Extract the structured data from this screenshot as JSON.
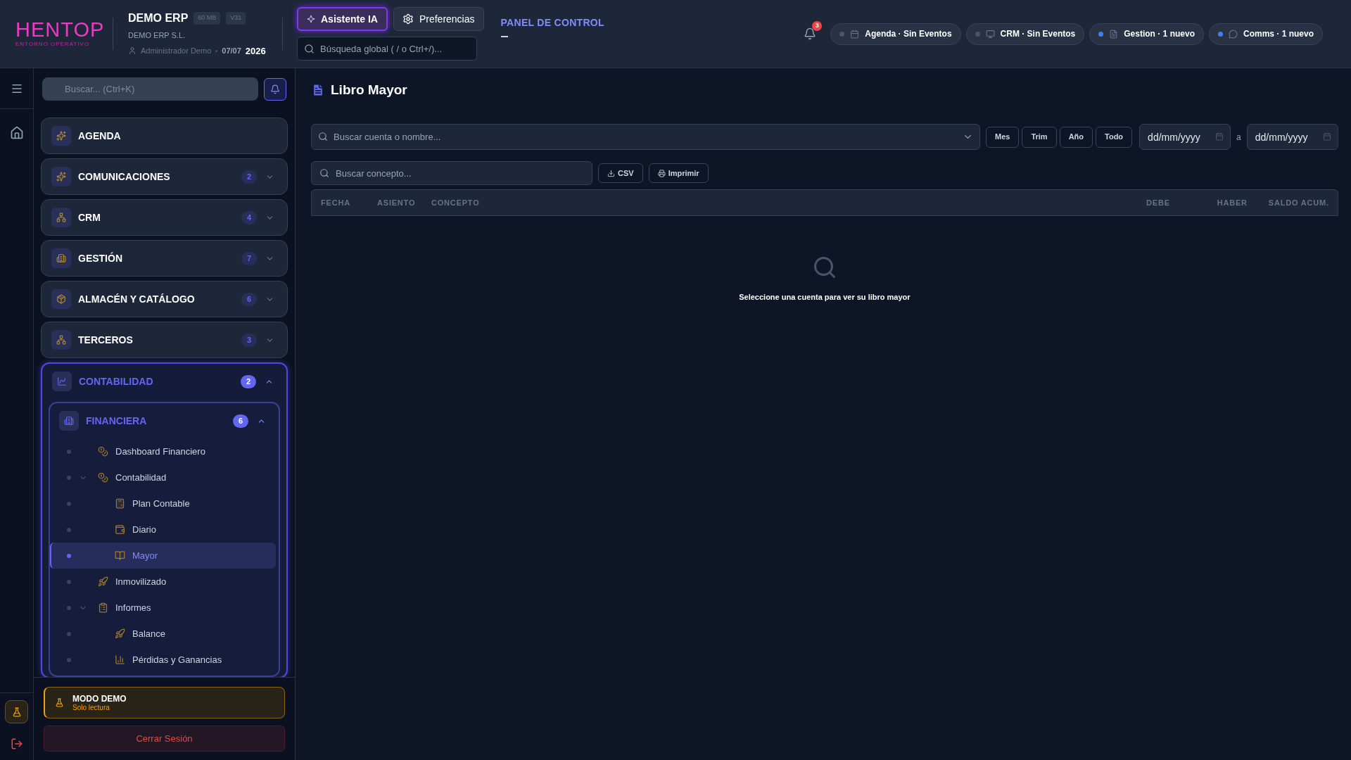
{
  "header": {
    "logo": {
      "name": "HENTOP",
      "tagline": "ENTORNO OPERATIVO"
    },
    "company": {
      "name": "DEMO ERP",
      "badges": [
        "60 MB",
        "V31"
      ],
      "legal_name": "DEMO ERP S.L.",
      "user": "Administrador Demo",
      "date": "07/07",
      "year": "2026"
    },
    "buttons": [
      {
        "label": "Asistente IA",
        "kind": "ai",
        "selected": true
      },
      {
        "label": "Preferencias",
        "kind": "settings",
        "selected": false
      }
    ],
    "global_search": {
      "placeholder": "Búsqueda global ( / o Ctrl+/)..."
    },
    "panel_link": "PANEL DE CONTROL",
    "notifications": "3",
    "status_pills": [
      {
        "label": "Agenda · Sin Eventos",
        "kind": "calendar",
        "active": false
      },
      {
        "label": "CRM · Sin Eventos",
        "kind": "screen",
        "active": false
      },
      {
        "label": "Gestion · 1 nuevo",
        "kind": "file",
        "active": true
      },
      {
        "label": "Comms · 1 nuevo",
        "kind": "chat",
        "active": true
      }
    ]
  },
  "sidebar": {
    "search": {
      "placeholder": "Buscar... (Ctrl+K)"
    },
    "modules": [
      {
        "label": "AGENDA",
        "expanded": false
      },
      {
        "label": "COMUNICACIONES",
        "count": "2",
        "expanded": false
      },
      {
        "label": "CRM",
        "count": "4",
        "expanded": false
      },
      {
        "label": "GESTIÓN",
        "count": "7",
        "expanded": false
      },
      {
        "label": "ALMACÉN Y CATÁLOGO",
        "count": "6",
        "expanded": false
      },
      {
        "label": "TERCEROS",
        "count": "3",
        "expanded": false
      },
      {
        "label": "CONTABILIDAD",
        "count": "2",
        "expanded": true,
        "groups": [
          {
            "label": "FINANCIERA",
            "count": "6",
            "expanded": true,
            "items": [
              {
                "label": "Dashboard Financiero",
                "selected": false
              },
              {
                "label": "Contabilidad",
                "selected": false,
                "expanded": true,
                "children": [
                  {
                    "label": "Plan Contable",
                    "selected": false
                  },
                  {
                    "label": "Diario",
                    "selected": false
                  },
                  {
                    "label": "Mayor",
                    "selected": true
                  }
                ]
              },
              {
                "label": "Inmovilizado",
                "selected": false
              },
              {
                "label": "Informes",
                "selected": false,
                "expanded": true,
                "children": [
                  {
                    "label": "Balance",
                    "selected": false
                  },
                  {
                    "label": "Pérdidas y Ganancias",
                    "selected": false
                  }
                ]
              }
            ]
          }
        ]
      }
    ],
    "demo": {
      "title": "MODO DEMO",
      "subtitle": "Solo lectura"
    },
    "logout": "Cerrar Sesión"
  },
  "main": {
    "title": "Libro Mayor",
    "account_search": {
      "placeholder": "Buscar cuenta o nombre..."
    },
    "period_buttons": [
      "Mes",
      "Trim",
      "Año",
      "Todo"
    ],
    "date_from": {
      "placeholder": "dd/mm/yyyy"
    },
    "date_separator": "a",
    "date_to": {
      "placeholder": "dd/mm/yyyy"
    },
    "concept_search": {
      "placeholder": "Buscar concepto..."
    },
    "export_buttons": [
      {
        "label": "CSV",
        "kind": "download"
      },
      {
        "label": "Imprimir",
        "kind": "print"
      }
    ],
    "table": {
      "columns": [
        "FECHA",
        "ASIENTO",
        "CONCEPTO",
        "DEBE",
        "HABER",
        "SALDO ACUM."
      ]
    },
    "empty_message": "Seleccione una cuenta para ver su libro mayor"
  }
}
